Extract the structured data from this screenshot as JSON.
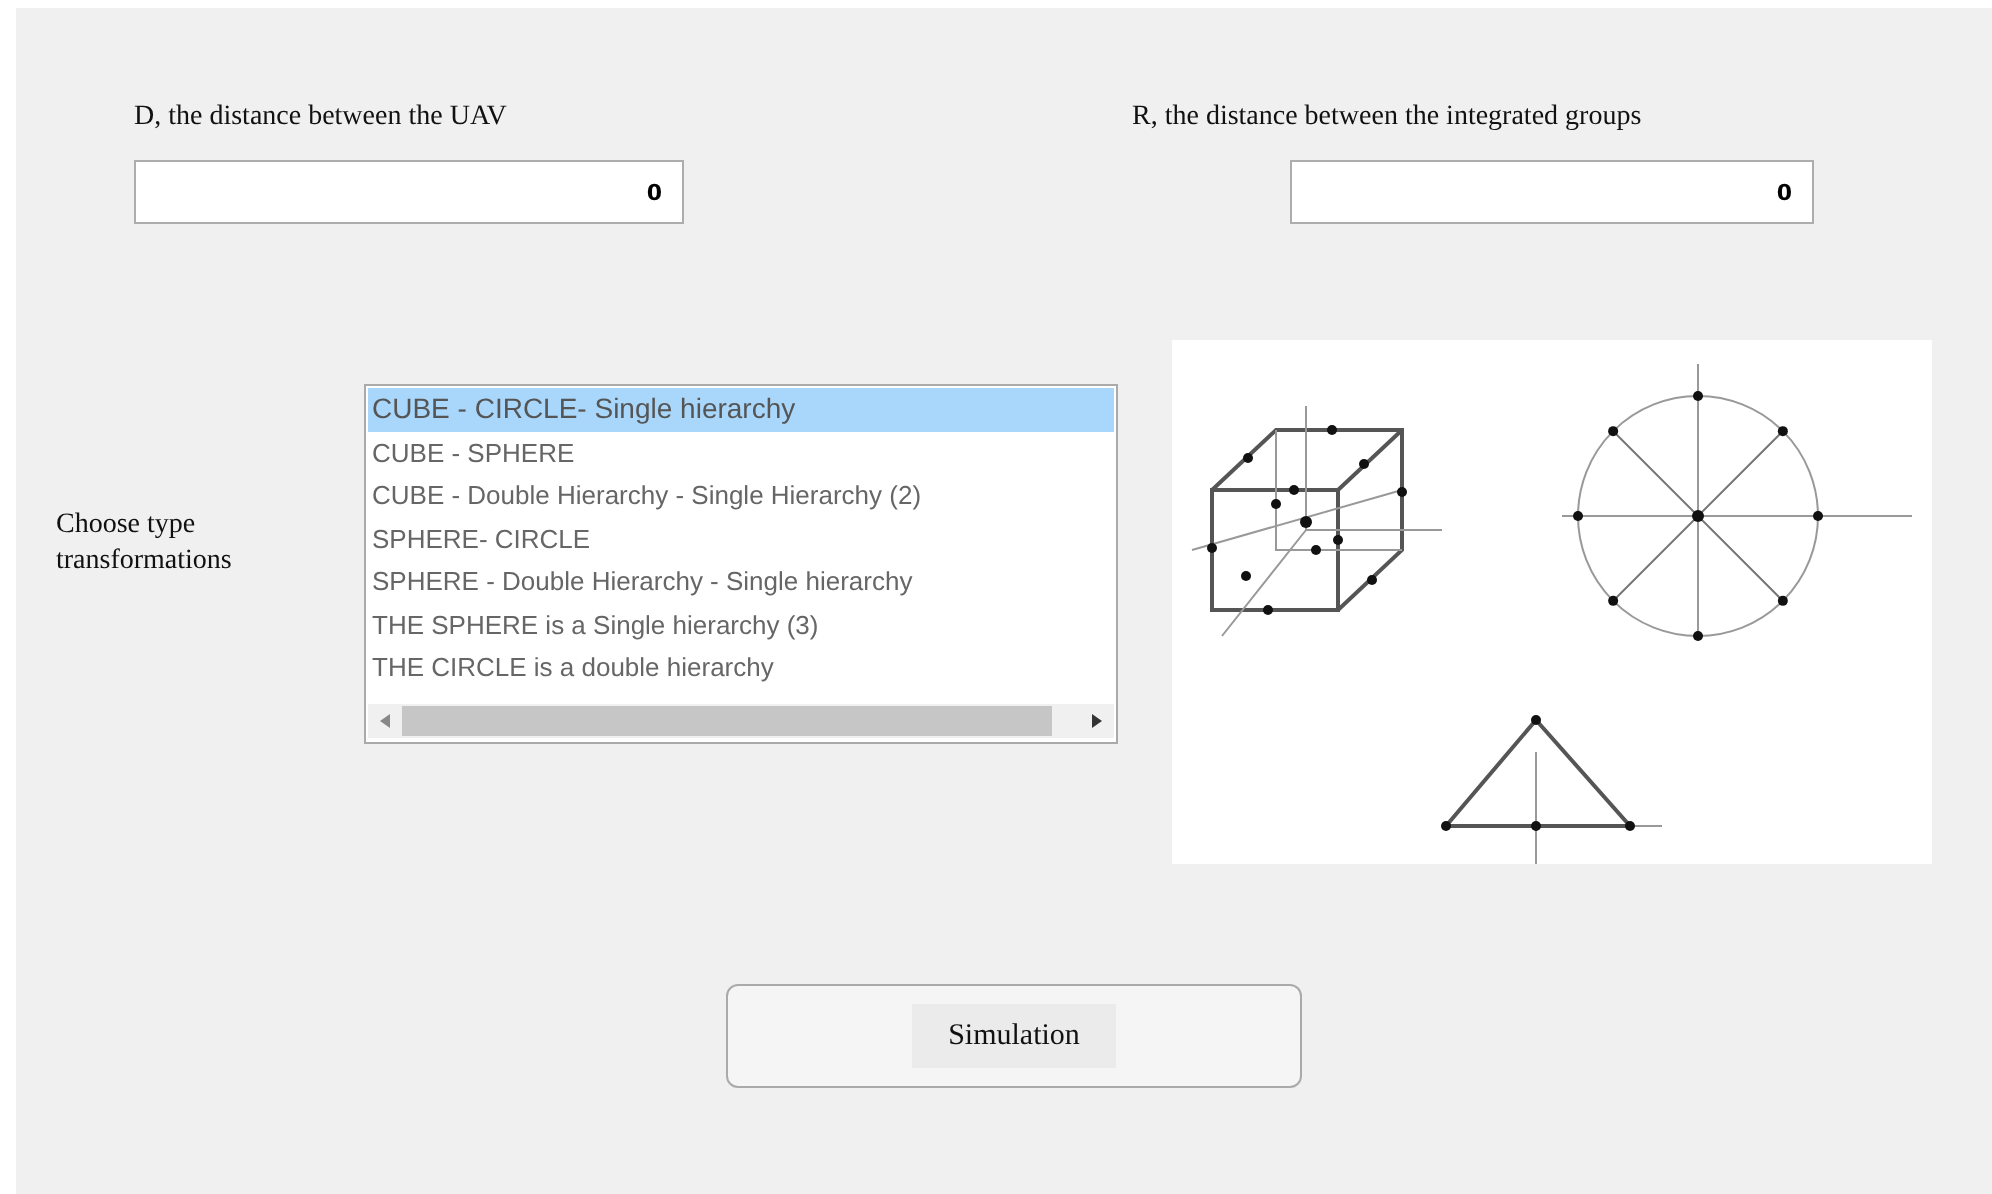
{
  "fields": [
    {
      "label": "D, the distance between the UAV",
      "value": "0"
    },
    {
      "label": "R, the distance between the integrated groups",
      "value": "0"
    }
  ],
  "list_label": "Choose type transformations",
  "list_items": [
    {
      "label": "CUBE - CIRCLE- Single hierarchy",
      "selected": true
    },
    {
      "label": "CUBE - SPHERE",
      "selected": false
    },
    {
      "label": "CUBE - Double Hierarchy - Single Hierarchy (2)",
      "selected": false
    },
    {
      "label": "SPHERE- CIRCLE",
      "selected": false
    },
    {
      "label": "SPHERE - Double Hierarchy - Single hierarchy",
      "selected": false
    },
    {
      "label": "THE SPHERE is a Single hierarchy (3)",
      "selected": false
    },
    {
      "label": "THE CIRCLE is a double hierarchy",
      "selected": false
    }
  ],
  "button": "Simulation"
}
